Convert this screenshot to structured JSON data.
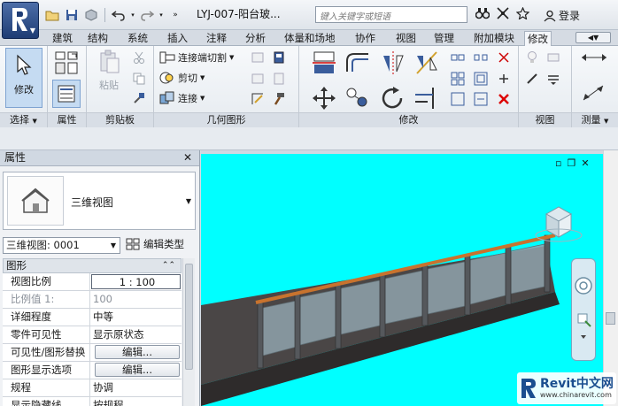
{
  "app": {
    "doc_title": "LYJ-007-阳台玻...",
    "search_placeholder": "键入关键字或短语",
    "login": "登录"
  },
  "tabs": [
    "建筑",
    "结构",
    "系统",
    "插入",
    "注释",
    "分析",
    "体量和场地",
    "协作",
    "视图",
    "管理",
    "附加模块",
    "修改"
  ],
  "active_tab": "修改",
  "ribbon": {
    "modify_label": "修改",
    "paste_label": "粘贴",
    "geometry": {
      "cut_join": "连接端切割",
      "cut": "剪切",
      "join": "连接"
    },
    "panels": {
      "select": "选择",
      "properties": "属性",
      "clipboard": "剪贴板",
      "geometry": "几何图形",
      "modify": "修改",
      "view": "视图",
      "measure": "测量"
    }
  },
  "properties": {
    "title": "属性",
    "type_name": "三维视图",
    "view_selector": "三维视图: 0001",
    "edit_type": "编辑类型",
    "group": "图形",
    "rows": [
      {
        "k": "视图比例",
        "v": "1 : 100",
        "kind": "input"
      },
      {
        "k": "比例值 1:",
        "v": "100",
        "kind": "dim"
      },
      {
        "k": "详细程度",
        "v": "中等",
        "kind": "text"
      },
      {
        "k": "零件可见性",
        "v": "显示原状态",
        "kind": "text"
      },
      {
        "k": "可见性/图形替换",
        "v": "编辑...",
        "kind": "button"
      },
      {
        "k": "图形显示选项",
        "v": "编辑...",
        "kind": "button"
      },
      {
        "k": "规程",
        "v": "协调",
        "kind": "text"
      },
      {
        "k": "显示隐藏线",
        "v": "按规程",
        "kind": "text"
      }
    ]
  },
  "watermark": {
    "title": "Revit中文网",
    "url": "www.chinarevit.com"
  },
  "colors": {
    "viewport_bg": "#00ffff",
    "handrail": "#c8732e",
    "glass": "#8fa3ad",
    "slab": "#4a4646",
    "accent": "#1e3c74"
  }
}
